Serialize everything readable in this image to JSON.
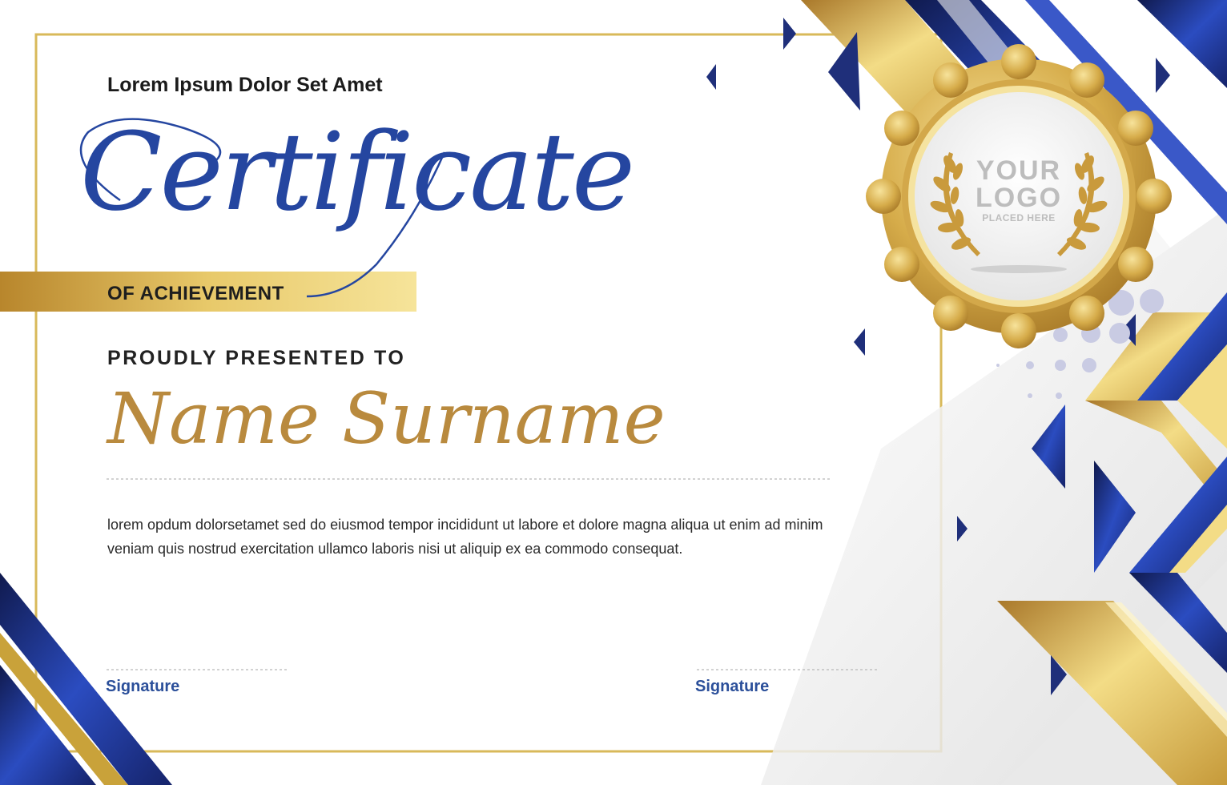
{
  "certificate": {
    "organization": "Lorem Ipsum Dolor Set Amet",
    "title": "Certificate",
    "subtitle": "OF ACHIEVEMENT",
    "presented_label": "PROUDLY PRESENTED TO",
    "recipient_name": "Name Surname",
    "body_text": "lorem opdum dolorsetamet sed do eiusmod tempor incididunt ut labore et dolore magna aliqua ut enim ad minim veniam quis nostrud exercitation ullamco laboris nisi ut aliquip ex ea commodo consequat.",
    "signature_left_label": "Signature",
    "signature_right_label": "Signature"
  },
  "seal": {
    "line1": "YOUR",
    "line2": "LOGO",
    "line3": "PLACED HERE",
    "icon": "laurel-wreath-icon"
  },
  "colors": {
    "navy": "#1f2f7a",
    "royal_blue": "#2546a0",
    "gold": "#c9a23a",
    "gold_light": "#f2dc85",
    "name_gold": "#b98a3e"
  }
}
